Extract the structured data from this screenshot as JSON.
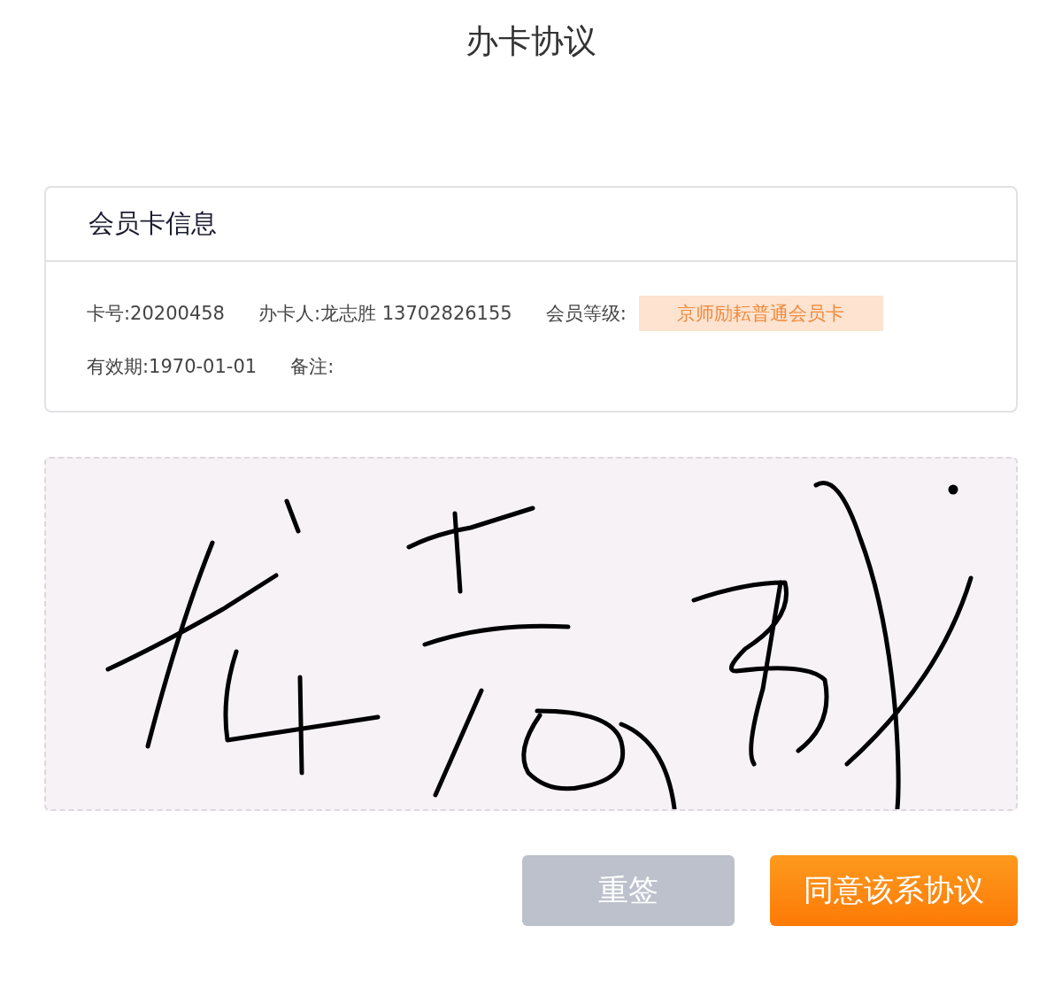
{
  "title": "办卡协议",
  "card": {
    "heading": "会员卡信息",
    "card_number": "卡号:20200458",
    "holder": "办卡人:龙志胜 13702826155",
    "level_label": "会员等级:",
    "level_value": "京师励耘普通会员卡",
    "validity": "有效期:1970-01-01",
    "remark": "备注:"
  },
  "signature": {
    "signed": true
  },
  "buttons": [
    {
      "label": "重签",
      "kind": "secondary"
    },
    {
      "label": "同意该系协议",
      "kind": "primary"
    }
  ]
}
